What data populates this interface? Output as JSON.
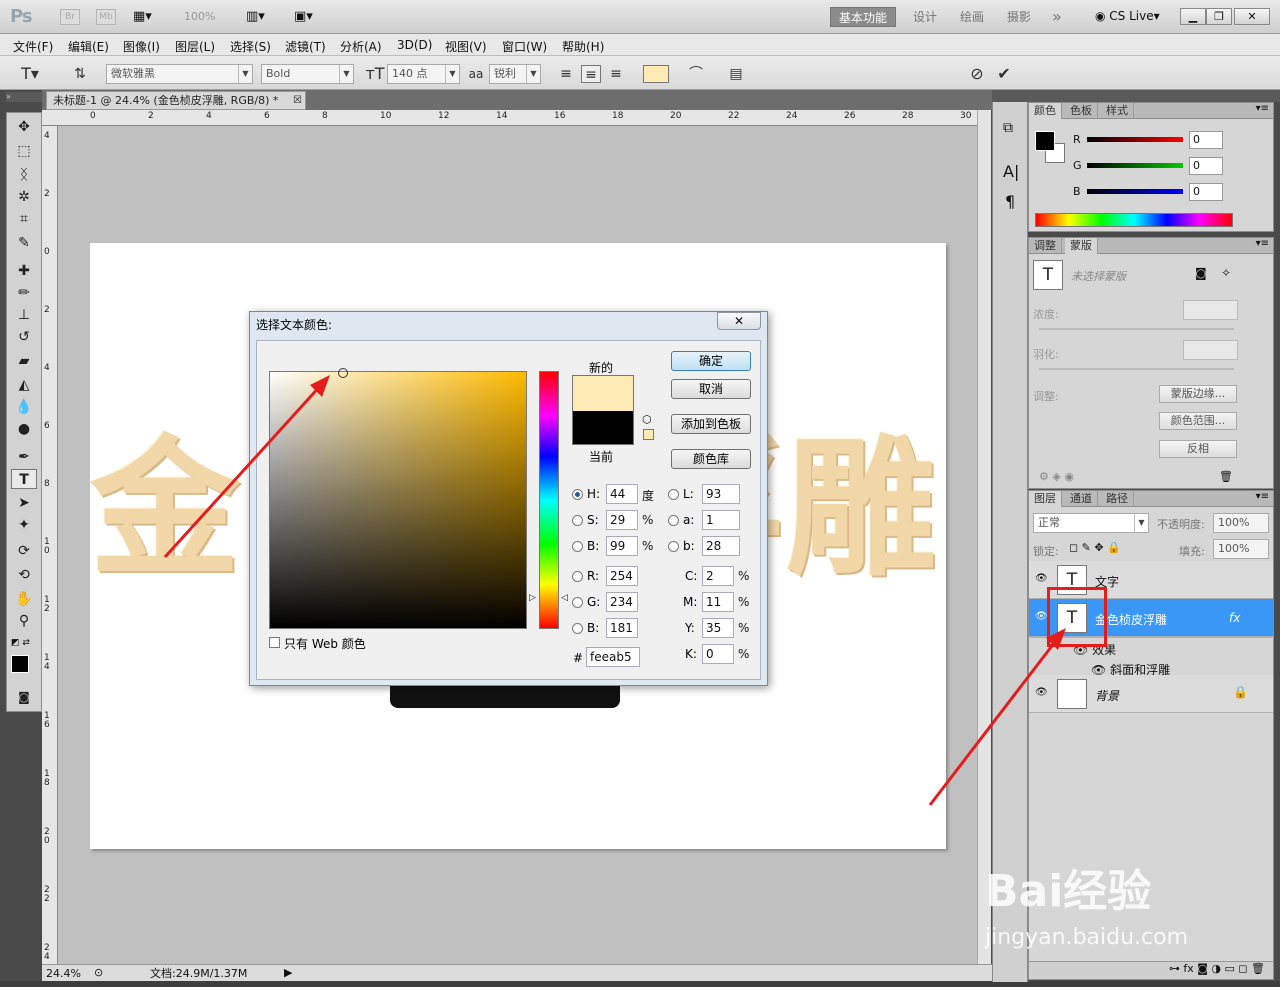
{
  "app": {
    "logo": "Ps",
    "br": "Br",
    "mb": "Mb",
    "zoom": "100%",
    "workspaces": [
      "基本功能",
      "设计",
      "绘画",
      "摄影"
    ],
    "more": "»",
    "cslive": "CS Live"
  },
  "menu": [
    "文件(F)",
    "编辑(E)",
    "图像(I)",
    "图层(L)",
    "选择(S)",
    "滤镜(T)",
    "分析(A)",
    "3D(D)",
    "视图(V)",
    "窗口(W)",
    "帮助(H)"
  ],
  "options": {
    "font": "微软雅黑",
    "style": "Bold",
    "size": "140 点",
    "aa_label": "aa",
    "aa": "锐利",
    "swatch_color": "#feeab5"
  },
  "document": {
    "tab_title": "未标题-1 @ 24.4% (金色桢皮浮雕, RGB/8) *",
    "zoom": "24.4%",
    "doc_size": "文档:24.9M/1.37M",
    "ruler_top": [
      "0",
      "2",
      "4",
      "6",
      "8",
      "10",
      "12",
      "14",
      "16",
      "18",
      "20",
      "22",
      "24",
      "26",
      "28",
      "30"
    ],
    "ruler_left": [
      "4",
      "2",
      "0",
      "2",
      "4",
      "6",
      "8",
      "1 0",
      "1 2",
      "1 4",
      "1 6",
      "1 8",
      "2 0",
      "2 2",
      "2 4"
    ],
    "canvas_text_left": "金",
    "canvas_text_right": "浮雕"
  },
  "color_panel": {
    "tabs": [
      "颜色",
      "色板",
      "样式"
    ],
    "r_label": "R",
    "g_label": "G",
    "b_label": "B",
    "r": "0",
    "g": "0",
    "b": "0"
  },
  "mask_panel": {
    "tabs": [
      "调整",
      "蒙版"
    ],
    "no_mask": "未选择蒙版",
    "density": "浓度:",
    "feather": "羽化:",
    "adjust": "调整:",
    "mask_edge": "蒙版边缘...",
    "color_range": "颜色范围...",
    "invert": "反相"
  },
  "layers_panel": {
    "tabs": [
      "图层",
      "通道",
      "路径"
    ],
    "blend": "正常",
    "opacity_label": "不透明度:",
    "opacity": "100%",
    "lock_label": "锁定:",
    "fill_label": "填充:",
    "fill": "100%",
    "layers": [
      {
        "name": "文字",
        "thumb": "T"
      },
      {
        "name": "金色桢皮浮雕",
        "thumb": "T",
        "fx": "fx"
      },
      {
        "name": "背景",
        "thumb": ""
      }
    ],
    "effects": "效果",
    "bevel": "斜面和浮雕"
  },
  "dialog": {
    "title": "选择文本颜色:",
    "close": "✕",
    "new_label": "新的",
    "current_label": "当前",
    "new_color": "#feeab5",
    "current_color": "#000000",
    "ok": "确定",
    "cancel": "取消",
    "add_swatch": "添加到色板",
    "libraries": "颜色库",
    "H": "44",
    "S": "29",
    "B": "99",
    "L": "93",
    "a": "1",
    "b": "28",
    "R": "254",
    "G": "234",
    "Bv": "181",
    "C": "2",
    "M": "11",
    "Y": "35",
    "K": "0",
    "deg": "度",
    "pct": "%",
    "hex_label": "#",
    "hex": "feeab5",
    "web_only": "只有 Web 颜色"
  },
  "watermark": {
    "line1": "Bai经验",
    "line2": "jingyan.baidu.com"
  }
}
